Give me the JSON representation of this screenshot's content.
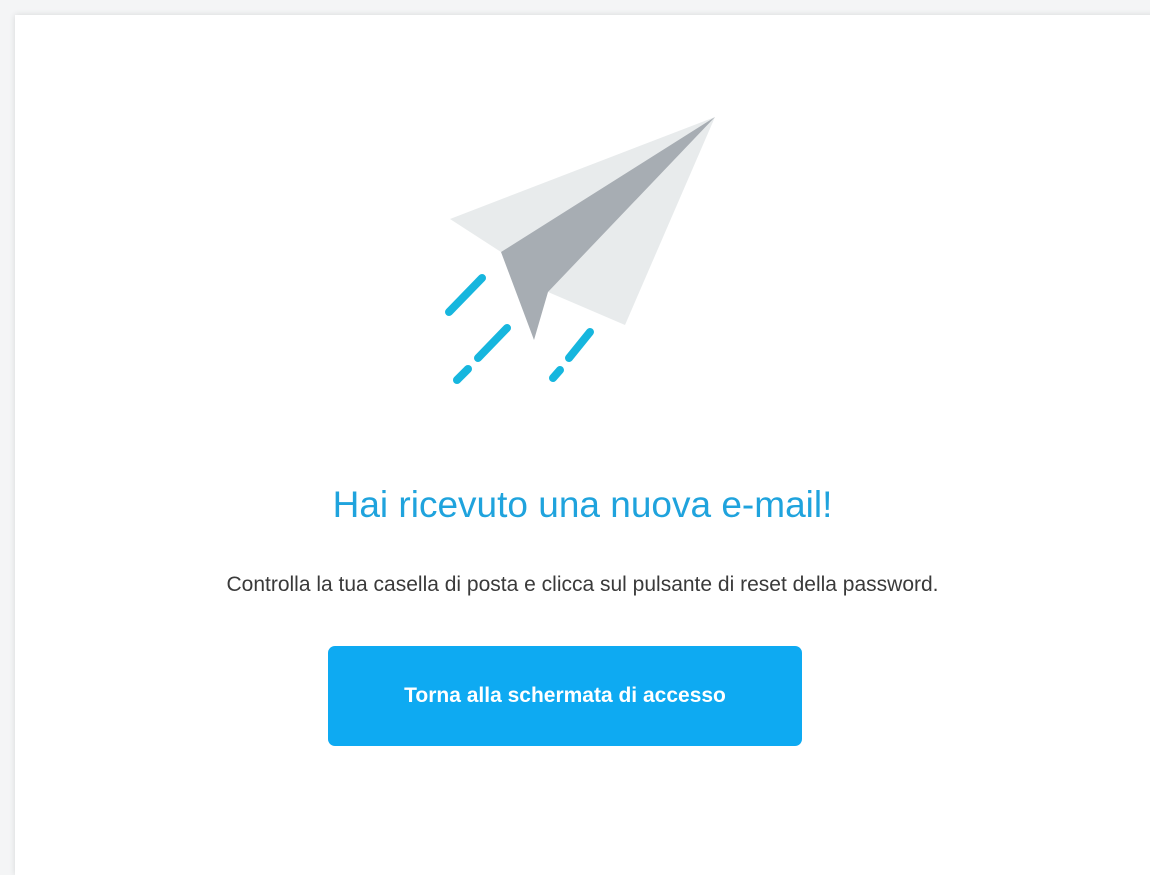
{
  "illustration": {
    "icon": "paper-plane-icon",
    "colors": {
      "plane_light": "#e8ebec",
      "plane_dark": "#a7adb3",
      "speed_lines": "#16b6de"
    }
  },
  "confirmation": {
    "title": "Hai ricevuto una nuova e-mail!",
    "message": "Controlla la tua casella di posta e clicca sul pulsante di reset della password.",
    "back_button_label": "Torna alla schermata di accesso"
  },
  "colors": {
    "accent": "#1fa3dd",
    "button": "#0eaaf2",
    "text": "#3a3a3a"
  }
}
